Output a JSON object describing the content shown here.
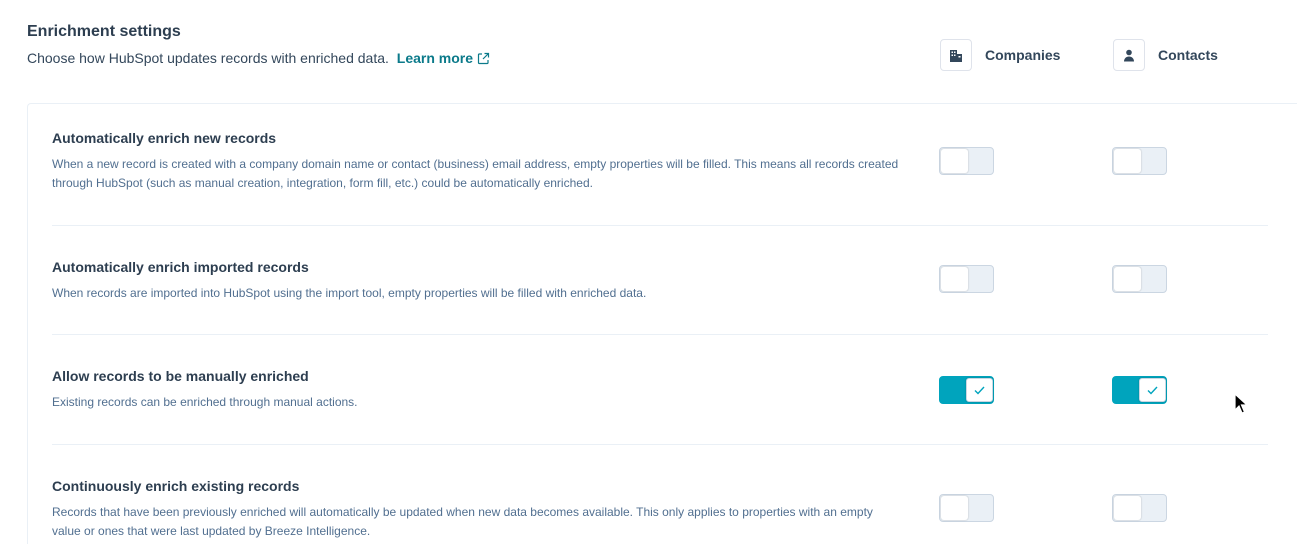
{
  "header": {
    "title": "Enrichment settings",
    "subtitle": "Choose how HubSpot updates records with enriched data.",
    "learn_more": "Learn more"
  },
  "columns": {
    "companies": {
      "label": "Companies",
      "icon": "building-icon"
    },
    "contacts": {
      "label": "Contacts",
      "icon": "person-icon"
    }
  },
  "settings": [
    {
      "title": "Automatically enrich new records",
      "description": "When a new record is created with a company domain name or contact (business) email address, empty properties will be filled. This means all records created through HubSpot (such as manual creation, integration, form fill, etc.) could be automatically enriched.",
      "companies": false,
      "contacts": false
    },
    {
      "title": "Automatically enrich imported records",
      "description": "When records are imported into HubSpot using the import tool, empty properties will be filled with enriched data.",
      "companies": false,
      "contacts": false
    },
    {
      "title": "Allow records to be manually enriched",
      "description": "Existing records can be enriched through manual actions.",
      "companies": true,
      "contacts": true
    },
    {
      "title": "Continuously enrich existing records",
      "description": "Records that have been previously enriched will automatically be updated when new data becomes available. This only applies to properties with an empty value or ones that were last updated by Breeze Intelligence.",
      "companies": false,
      "contacts": false
    }
  ],
  "colors": {
    "accent": "#00a4bd",
    "link": "#0b7a8a",
    "heading": "#2d3e50",
    "body_text": "#516f90",
    "border": "#cbd6e2"
  }
}
